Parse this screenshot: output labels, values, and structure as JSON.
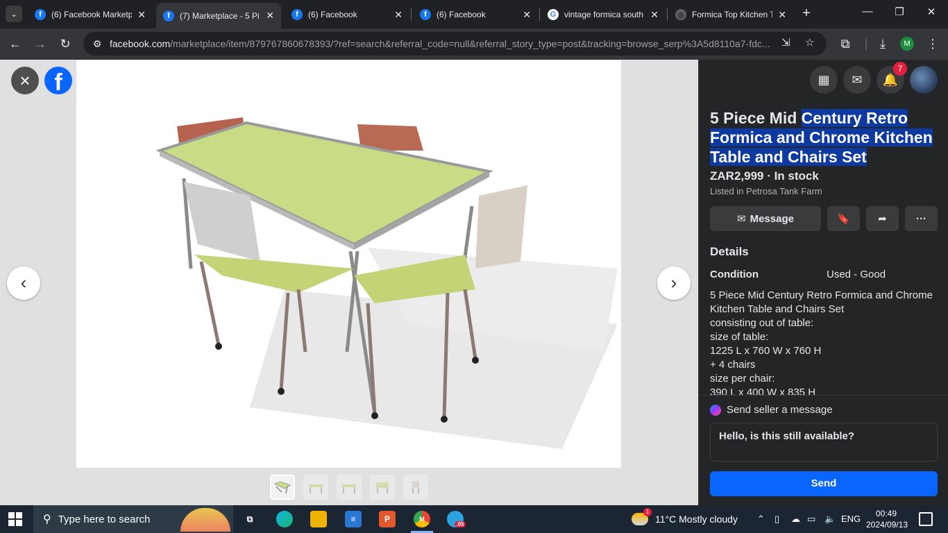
{
  "browser": {
    "tabs": [
      {
        "label": "(6) Facebook Marketp",
        "favicon": "facebook-icon",
        "active": false
      },
      {
        "label": "(7) Marketplace - 5 Pi",
        "favicon": "facebook-icon",
        "active": true
      },
      {
        "label": "(6) Facebook",
        "favicon": "facebook-icon",
        "active": false
      },
      {
        "label": "(6) Facebook",
        "favicon": "facebook-icon",
        "active": false
      },
      {
        "label": "vintage formica south",
        "favicon": "google-icon",
        "active": false
      },
      {
        "label": "Formica Top Kitchen T",
        "favicon": "globe-icon",
        "active": false
      }
    ],
    "url_host": "facebook.com",
    "url_path": "/marketplace/item/879767860678393/?ref=search&referral_code=null&referral_story_type=post&tracking=browse_serp%3A5d8110a7-fdc...",
    "profile_initial": "M"
  },
  "viewer": {
    "logo_letter": "f"
  },
  "listing": {
    "title_plain": "5 Piece Mid ",
    "title_highlighted": "Century Retro Formica and Chrome Kitchen Table and Chairs Set",
    "price_status": "ZAR2,999 · In stock",
    "listed_in": "Listed in Petrosa Tank Farm",
    "message_label": "Message",
    "notifications_count": "7",
    "details_heading": "Details",
    "condition_label": "Condition",
    "condition_value": "Used - Good",
    "description": "5 Piece Mid Century Retro Formica and Chrome Kitchen Table and Chairs Set\nconsisting out of table:\nsize of table:\n1225 L x 760 W x 760 H\n+ 4 chairs\nsize per chair:\n390 L x 400 W x 835 H"
  },
  "send": {
    "heading": "Send seller a message",
    "message_value": "Hello, is this still available?",
    "button_label": "Send"
  },
  "taskbar": {
    "search_placeholder": "Type here to search",
    "weather_text": "11°C  Mostly cloudy",
    "weather_badge": "1",
    "language": "ENG",
    "time": "00:49",
    "date": "2024/09/13",
    "chrome_badge": "M",
    "telegram_badge": ".05"
  },
  "colors": {
    "accent": "#0866ff",
    "highlight": "#0c3aa0",
    "panel_bg": "#242526",
    "notification_badge": "#e41e3f"
  }
}
